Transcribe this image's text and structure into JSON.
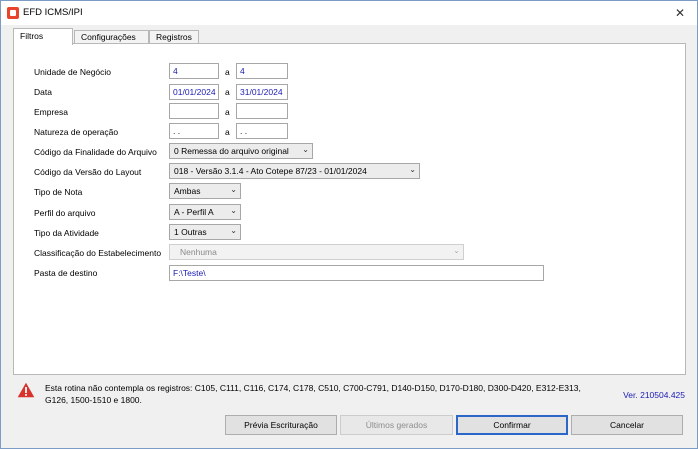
{
  "window": {
    "title": "EFD ICMS/IPI",
    "close_glyph": "✕"
  },
  "tabs": [
    {
      "label": "Filtros",
      "active": true
    },
    {
      "label": "Configurações",
      "active": false
    },
    {
      "label": "Registros",
      "active": false
    }
  ],
  "form": {
    "unidade": {
      "label": "Unidade de Negócio",
      "from": "4",
      "sep": "a",
      "to": "4"
    },
    "data": {
      "label": "Data",
      "from": "01/01/2024",
      "sep": "a",
      "to": "31/01/2024"
    },
    "empresa": {
      "label": "Empresa",
      "from": "",
      "sep": "a",
      "to": ""
    },
    "natureza": {
      "label": "Natureza de operação",
      "from": " .  .",
      "sep": "a",
      "to": " .  ."
    },
    "finalidade": {
      "label": "Código da Finalidade do Arquivo",
      "value": "0 Remessa do arquivo original"
    },
    "versao": {
      "label": "Código da Versão do Layout",
      "value": "018 - Versão 3.1.4 - Ato Cotepe 87/23 - 01/01/2024"
    },
    "tipo_nota": {
      "label": "Tipo de Nota",
      "value": "Ambas"
    },
    "perfil": {
      "label": "Perfil do arquivo",
      "value": "A - Perfil A"
    },
    "atividade": {
      "label": "Tipo da Atividade",
      "value": "1 Outras"
    },
    "classificacao": {
      "label": "Classificação do Estabelecimento",
      "value": "Nenhuma"
    },
    "pasta": {
      "label": "Pasta de destino",
      "value": "F:\\Teste\\"
    }
  },
  "notice": {
    "text": "Esta rotina não contempla os registros: C105, C111, C116, C174, C178, C510, C700-C791, D140-D150, D170-D180, D300-D420, E312-E313, G126, 1500-1510 e 1800.",
    "version": "Ver. 210504.425"
  },
  "buttons": {
    "previa": "Prévia Escrituração",
    "ultimos": "Últimos gerados",
    "confirmar": "Confirmar",
    "cancelar": "Cancelar"
  },
  "colors": {
    "accent": "#2a67c8",
    "value_text": "#1b1bb5",
    "warning": "#d9312c"
  }
}
